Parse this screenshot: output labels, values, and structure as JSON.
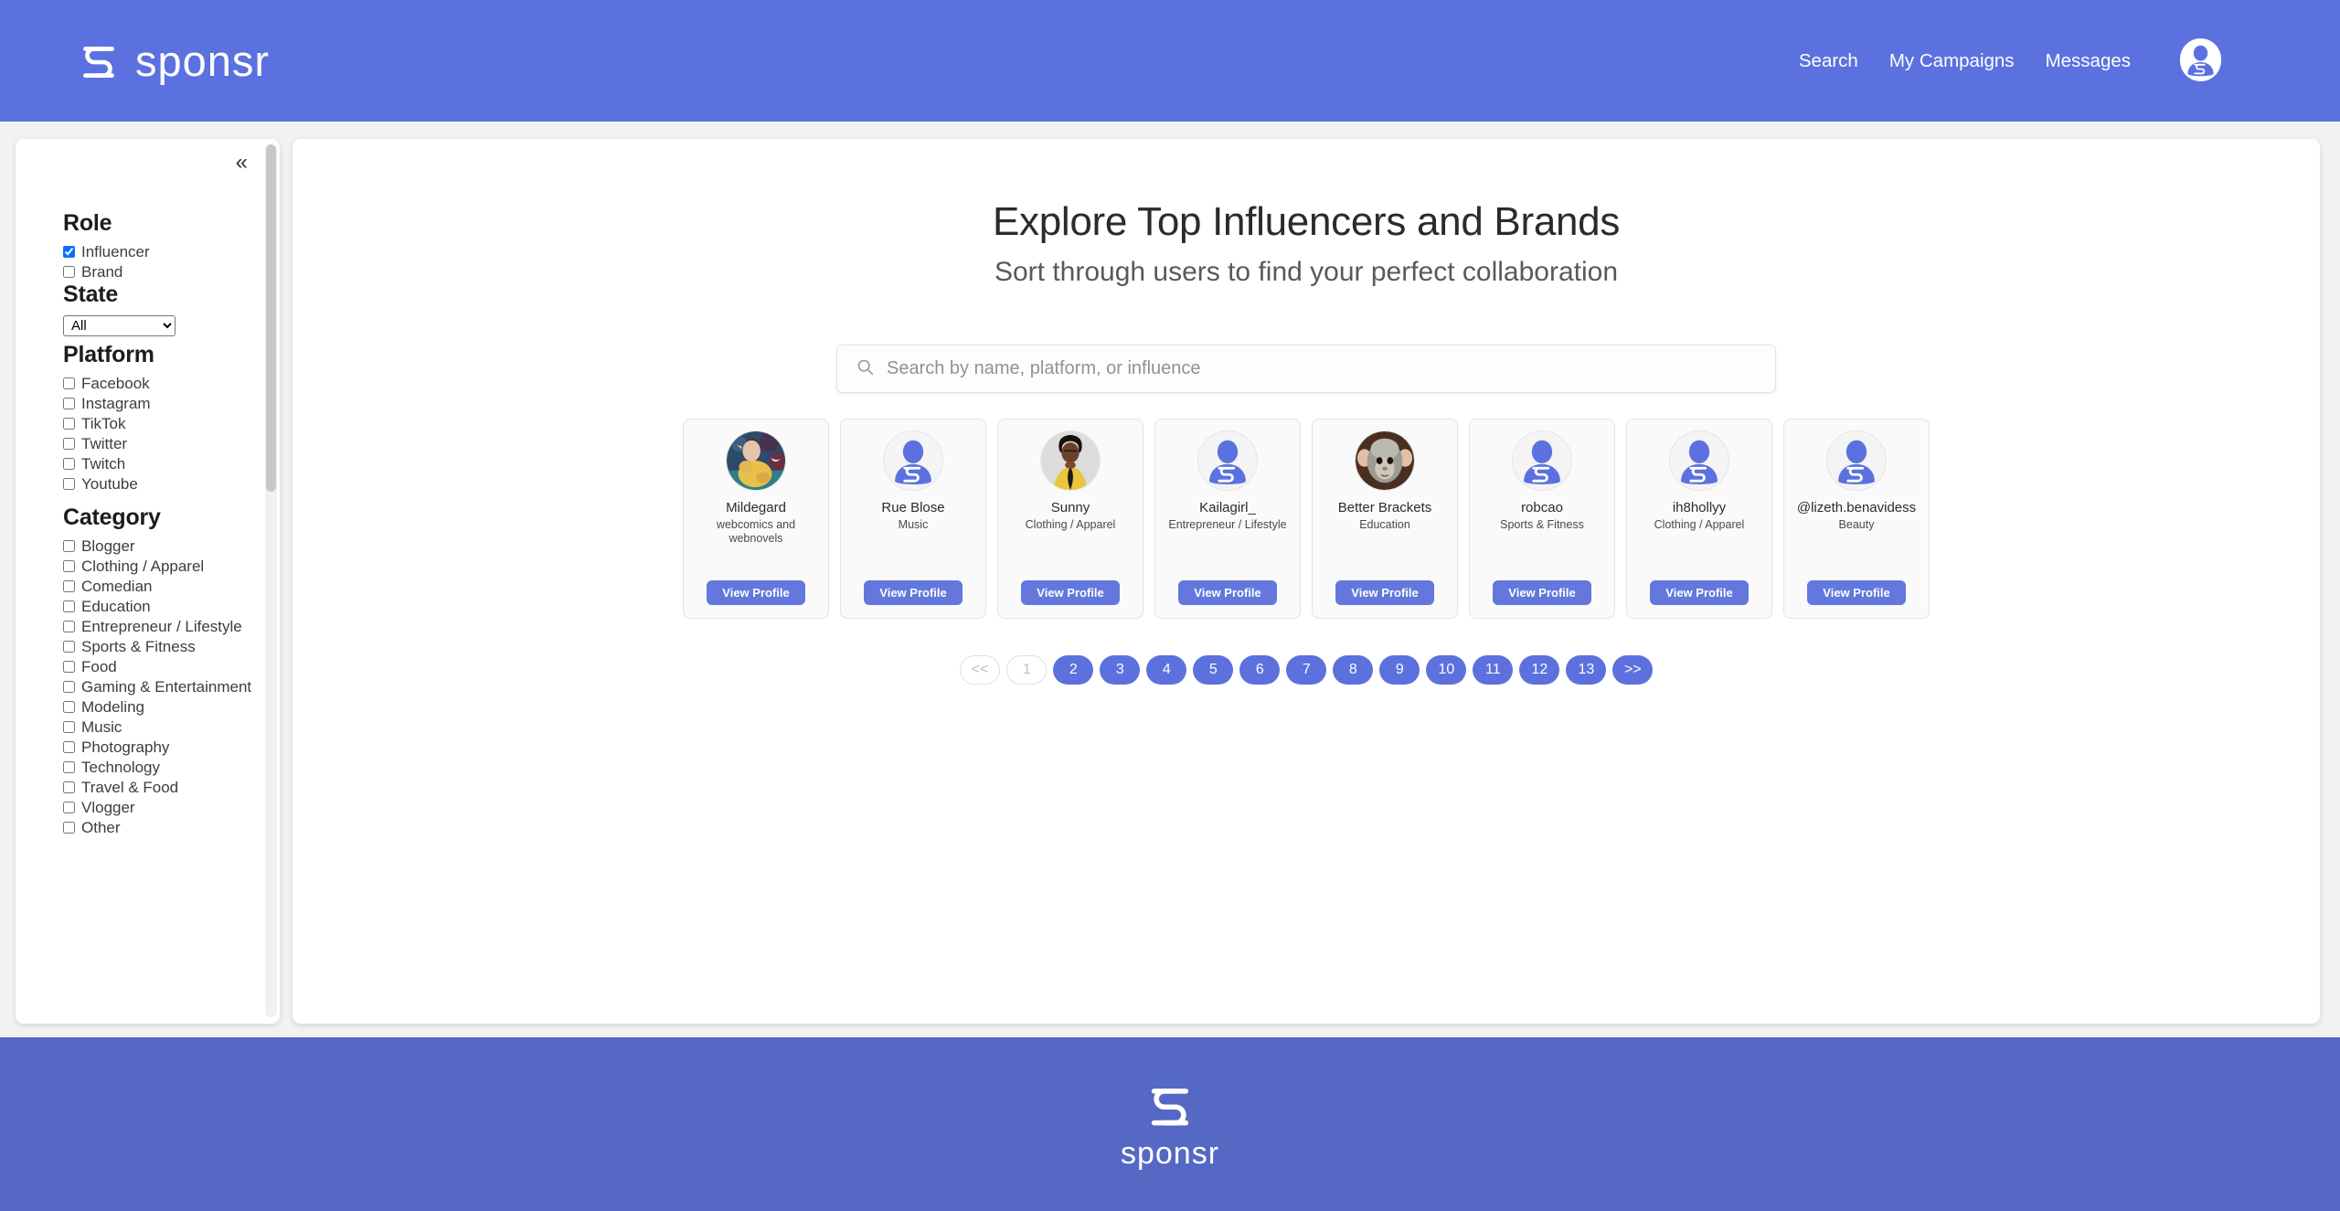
{
  "brand": {
    "name": "sponsr",
    "logo_icon": "sponsr-s-logo"
  },
  "header": {
    "nav": [
      {
        "label": "Search",
        "name": "nav-search"
      },
      {
        "label": "My Campaigns",
        "name": "nav-my-campaigns"
      },
      {
        "label": "Messages",
        "name": "nav-messages"
      }
    ],
    "avatar_icon": "user-avatar-icon",
    "bg_color": "#5b71e0"
  },
  "sidebar": {
    "collapse_icon": "chevron-double-left-icon",
    "role": {
      "title": "Role",
      "options": [
        {
          "label": "Influencer",
          "checked": true
        },
        {
          "label": "Brand",
          "checked": false
        }
      ]
    },
    "state": {
      "title": "State",
      "selected": "All",
      "options": [
        "All"
      ]
    },
    "platform": {
      "title": "Platform",
      "options": [
        {
          "label": "Facebook",
          "checked": false
        },
        {
          "label": "Instagram",
          "checked": false
        },
        {
          "label": "TikTok",
          "checked": false
        },
        {
          "label": "Twitter",
          "checked": false
        },
        {
          "label": "Twitch",
          "checked": false
        },
        {
          "label": "Youtube",
          "checked": false
        }
      ]
    },
    "category": {
      "title": "Category",
      "options": [
        {
          "label": "Blogger",
          "checked": false
        },
        {
          "label": "Clothing / Apparel",
          "checked": false
        },
        {
          "label": "Comedian",
          "checked": false
        },
        {
          "label": "Education",
          "checked": false
        },
        {
          "label": "Entrepreneur / Lifestyle",
          "checked": false
        },
        {
          "label": "Sports & Fitness",
          "checked": false
        },
        {
          "label": "Food",
          "checked": false
        },
        {
          "label": "Gaming & Entertainment",
          "checked": false
        },
        {
          "label": "Modeling",
          "checked": false
        },
        {
          "label": "Music",
          "checked": false
        },
        {
          "label": "Photography",
          "checked": false
        },
        {
          "label": "Technology",
          "checked": false
        },
        {
          "label": "Travel & Food",
          "checked": false
        },
        {
          "label": "Vlogger",
          "checked": false
        },
        {
          "label": "Other",
          "checked": false
        }
      ]
    }
  },
  "main": {
    "title": "Explore Top Influencers and Brands",
    "subtitle": "Sort through users to find your perfect collaboration",
    "search": {
      "placeholder": "Search by name, platform, or influence",
      "value": "",
      "icon": "search-icon"
    },
    "view_profile_label": "View Profile",
    "cards": [
      {
        "name": "Mildegard",
        "category": "webcomics and webnovels",
        "avatar": "photo-elf-dragon"
      },
      {
        "name": "Rue Blose",
        "category": "Music",
        "avatar": "default-sponsr-avatar"
      },
      {
        "name": "Sunny",
        "category": "Clothing / Apparel",
        "avatar": "photo-woman-yellow"
      },
      {
        "name": "Kailagirl_",
        "category": "Entrepreneur / Lifestyle",
        "avatar": "default-sponsr-avatar"
      },
      {
        "name": "Better Brackets",
        "category": "Education",
        "avatar": "photo-monkey"
      },
      {
        "name": "robcao",
        "category": "Sports & Fitness",
        "avatar": "default-sponsr-avatar"
      },
      {
        "name": "ih8hollyy",
        "category": "Clothing / Apparel",
        "avatar": "default-sponsr-avatar"
      },
      {
        "name": "@lizeth.benavidess",
        "category": "Beauty",
        "avatar": "default-sponsr-avatar"
      }
    ],
    "pagination": {
      "prev_label": "<<",
      "next_label": ">>",
      "current": "1",
      "pages": [
        "1",
        "2",
        "3",
        "4",
        "5",
        "6",
        "7",
        "8",
        "9",
        "10",
        "11",
        "12",
        "13"
      ]
    }
  },
  "footer": {
    "brand": "sponsr",
    "bg_color": "#5468c4"
  },
  "colors": {
    "accent": "#5b71e0",
    "button": "#6377dd",
    "page_bg": "#f2f2f2"
  }
}
